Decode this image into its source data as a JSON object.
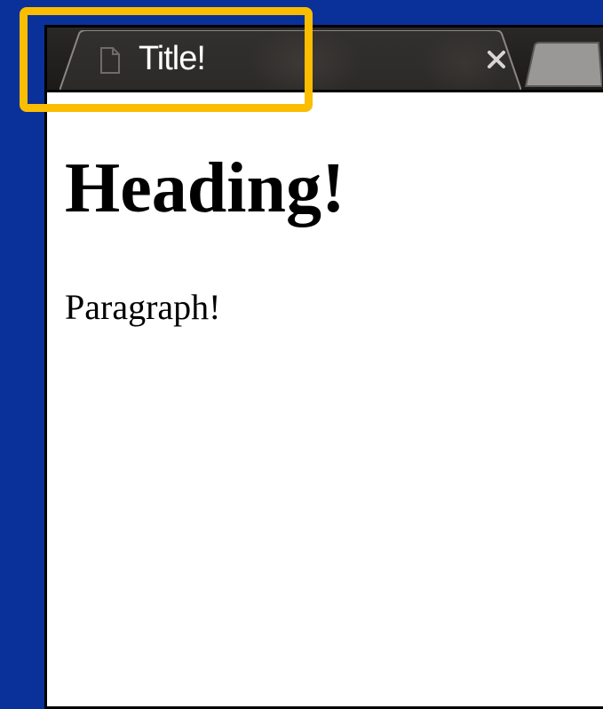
{
  "tab": {
    "title": "Title!",
    "page_icon": "document-icon",
    "close_icon": "close-icon",
    "new_tab_icon": "new-tab-icon"
  },
  "page": {
    "heading": "Heading!",
    "paragraph": "Paragraph!"
  },
  "annotation": {
    "highlight_color": "#fbbd00"
  },
  "colors": {
    "desktop_background": "#0a3199",
    "tab_strip": "#1c1a19",
    "content_background": "#ffffff"
  }
}
